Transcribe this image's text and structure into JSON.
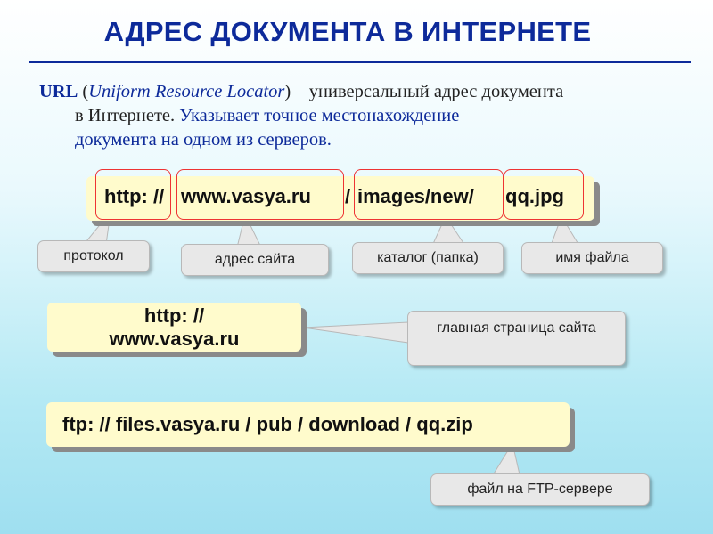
{
  "title": "АДРЕС ДОКУМЕНТА В ИНТЕРНЕТЕ",
  "description": {
    "abbr": "URL",
    "paren_open": " (",
    "full_name": "Uniform Resource Locator",
    "paren_close": ")",
    "dash_text": " – универсальный адрес документа",
    "line2_start": "в Интернете. ",
    "line2_hl": "Указывает точное местонахождение",
    "line3": "документа на одном из серверов."
  },
  "url_example": {
    "protocol": "http: //",
    "site": "www.vasya.ru",
    "sep": "/",
    "catalog": "images/new/",
    "file": "qq.jpg"
  },
  "callouts": {
    "protocol": "протокол",
    "site": "адрес сайта",
    "catalog": "каталог (папка)",
    "file": "имя файла"
  },
  "home_example": {
    "line1": "http: //",
    "line2": "www.vasya.ru",
    "note": "главная страница сайта"
  },
  "ftp_example": {
    "url": "ftp: // files.vasya.ru / pub / download / qq.zip",
    "note": "файл на FTP-сервере"
  },
  "colors": {
    "title": "#0d2a9a",
    "box_fill": "#fffbcc",
    "frame": "#e33333",
    "callout_fill": "#e8e8e8"
  }
}
